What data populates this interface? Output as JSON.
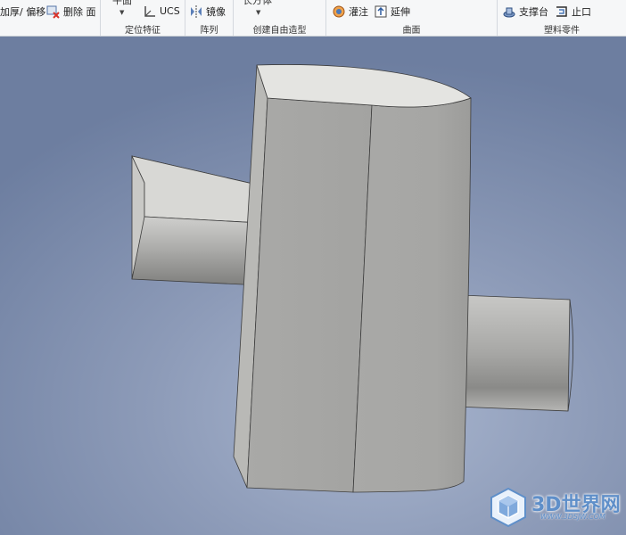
{
  "ribbon": {
    "modify_group": {
      "thicken_label": "加厚/ 偏移",
      "delete_face_label": "删除 面"
    },
    "work_features": {
      "plane_label": "平面",
      "ucs_label": "UCS",
      "group_label": "定位特征"
    },
    "pattern": {
      "mirror_label": "镜像",
      "group_label": "阵列"
    },
    "freeform": {
      "box_label": "长方体",
      "group_label": "创建自由造型"
    },
    "surface": {
      "patch_label": "灌注",
      "extend_label": "延伸",
      "group_label": "曲面"
    },
    "plastic_part": {
      "boss_label": "支撑台",
      "lip_label": "止口",
      "group_label": "塑料零件"
    }
  },
  "colors": {
    "ribbon_bg": "#f6f7f8",
    "viewport_top": "#6d7ea0",
    "viewport_mid": "#a9b6cf",
    "model_face": "#a8a8a6",
    "model_top": "#e2e2df"
  },
  "watermark": {
    "text": "3D世界网",
    "subtext": "WWW.3DSJW.COM"
  }
}
